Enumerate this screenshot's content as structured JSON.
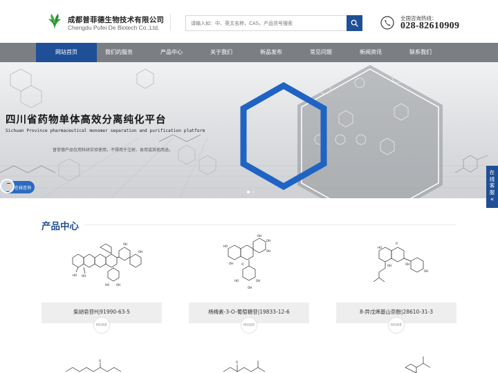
{
  "header": {
    "company_cn": "成都普菲德生物技术有限公司",
    "company_en": "Chengdu Pufei De Biotech Co.,Ltd.",
    "search_placeholder": "请输入如：中、英文名称，CAS，产品货号搜索",
    "hotline_label": "全国咨询热线：",
    "hotline_number": "028-82610909"
  },
  "nav": {
    "items": [
      "网站首页",
      "我们的服务",
      "产品中心",
      "关于我们",
      "新品发布",
      "常见问题",
      "新闻资讯",
      "联系我们"
    ],
    "active_index": 0
  },
  "banner": {
    "title": "四川省药物单体高效分离纯化平台",
    "subtitle": "Sichuan Province pharmaceutical monomer separation and purification platform",
    "note": "普菲德产品仅用科研实验使用，不得用于注射、食用或其他用途。",
    "slide_count": 2,
    "active_slide": 0
  },
  "online_service": {
    "label": "在线咨询"
  },
  "side_consult": {
    "label": [
      "在",
      "线",
      "客",
      "服",
      "«"
    ]
  },
  "products": {
    "title": "产品中心",
    "more_label": "MORE",
    "items": [
      {
        "name": "柴胡皂苷H|91990-63-5"
      },
      {
        "name": "杨梅素-3-O-葡萄糖苷|19833-12-6"
      },
      {
        "name": "8-异戊烯基山奈酚|28610-31-3"
      }
    ]
  },
  "colors": {
    "brand_blue": "#1f4f96",
    "nav_gray": "#7b7f84",
    "logo_green": "#2e9a3a"
  }
}
